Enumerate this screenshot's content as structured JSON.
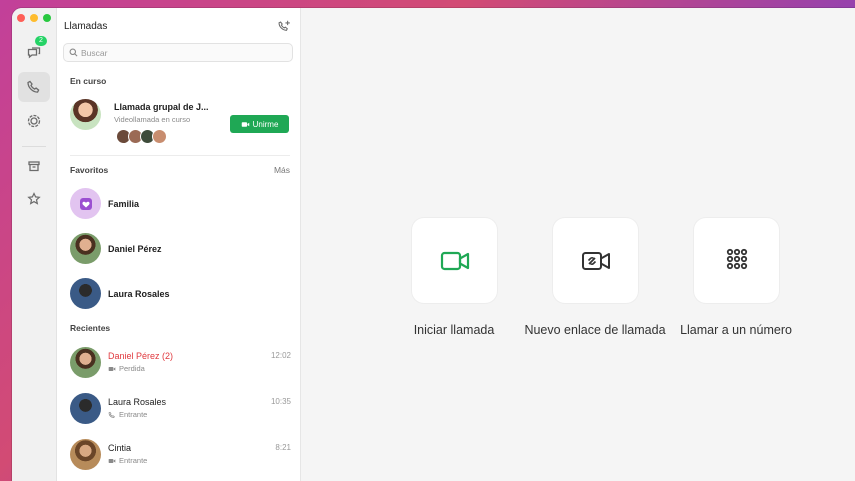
{
  "colors": {
    "traffic_close": "#fe5f57",
    "traffic_min": "#febc2e",
    "traffic_max": "#28c840",
    "accent_green": "#1fa855",
    "missed_red": "#e0393e",
    "badge_green": "#25d366"
  },
  "rail": {
    "chats_badge": "2",
    "icons": [
      "chats-icon",
      "phone-icon",
      "status-icon",
      "archive-icon",
      "star-icon"
    ]
  },
  "panel": {
    "title": "Llamadas",
    "search_placeholder": "Buscar"
  },
  "ongoing": {
    "section_label": "En curso",
    "name": "Llamada grupal de J...",
    "subtitle": "Videollamada en curso",
    "join_label": "Unirme"
  },
  "favorites": {
    "section_label": "Favoritos",
    "more_label": "Más",
    "items": [
      {
        "name": "Familia"
      },
      {
        "name": "Daniel Pérez"
      },
      {
        "name": "Laura Rosales"
      }
    ]
  },
  "recents": {
    "section_label": "Recientes",
    "items": [
      {
        "name": "Daniel Pérez (2)",
        "status": "Perdida",
        "time": "12:02",
        "missed": true,
        "kind": "video"
      },
      {
        "name": "Laura Rosales",
        "status": "Entrante",
        "time": "10:35",
        "missed": false,
        "kind": "audio"
      },
      {
        "name": "Cintia",
        "status": "Entrante",
        "time": "8:21",
        "missed": false,
        "kind": "video"
      }
    ]
  },
  "actions": [
    {
      "label": "Iniciar llamada",
      "icon": "video-camera-icon"
    },
    {
      "label": "Nuevo enlace de llamada",
      "icon": "video-link-icon"
    },
    {
      "label": "Llamar a un número",
      "icon": "dialpad-icon"
    }
  ]
}
